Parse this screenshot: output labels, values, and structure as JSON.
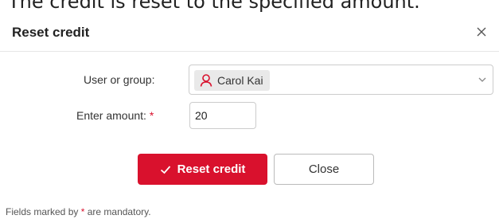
{
  "caption": "The credit is reset to the specified amount.",
  "dialog": {
    "title": "Reset credit",
    "close_icon": "close-icon",
    "user_group": {
      "label": "User or group:",
      "selected": "Carol Kai",
      "chip_icon": "user-icon",
      "dropdown_icon": "chevron-down-icon"
    },
    "amount": {
      "label": "Enter amount:",
      "required_mark": "*",
      "value": "20"
    },
    "buttons": {
      "reset_label": "Reset credit",
      "reset_icon": "check-icon",
      "close_label": "Close"
    },
    "footer": {
      "prefix": "Fields marked by",
      "star": "*",
      "suffix": "are mandatory."
    }
  },
  "colors": {
    "accent": "#d9112d",
    "chip_bg": "#e9e9e9"
  }
}
